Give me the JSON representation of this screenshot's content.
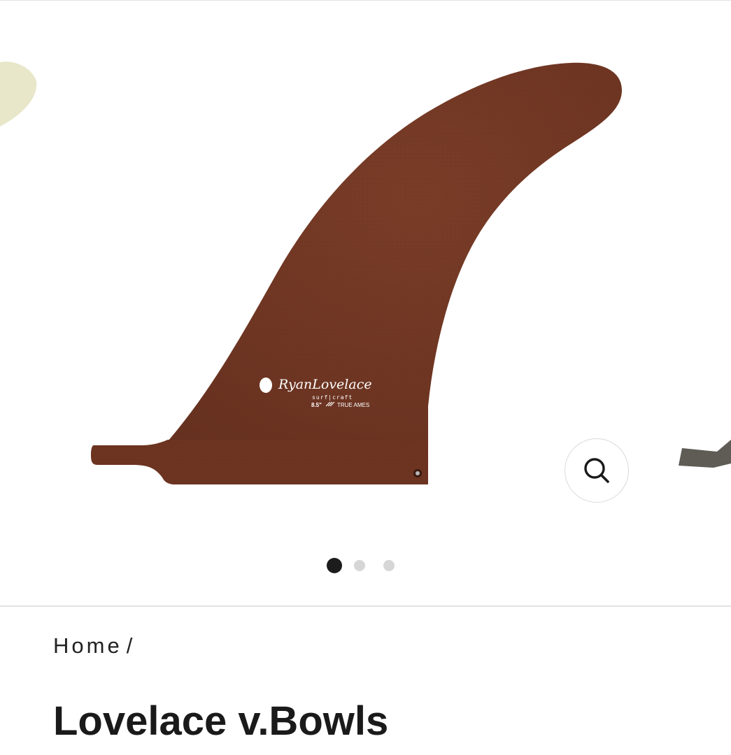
{
  "gallery": {
    "slides": [
      {
        "name": "fin-main-brown",
        "color": "#6e3522"
      },
      {
        "name": "fin-prev-clear",
        "color": "#e7e6c8"
      },
      {
        "name": "fin-next-grey",
        "color": "#5f5d56"
      }
    ],
    "fin_logo": {
      "script": "RyanLovelace",
      "sub": "surf|craft",
      "size": "8.5\"",
      "maker": "TRUE AMES"
    },
    "zoom_icon": "magnifier-icon",
    "pagination": {
      "total": 3,
      "active_index": 0
    }
  },
  "breadcrumb": {
    "home": "Home",
    "separator": "/"
  },
  "product": {
    "title": "Lovelace v.Bowls"
  },
  "colors": {
    "fin_main": "#6e3522",
    "dot_active": "#1c1c1c",
    "dot_inactive": "#d6d6d6"
  }
}
